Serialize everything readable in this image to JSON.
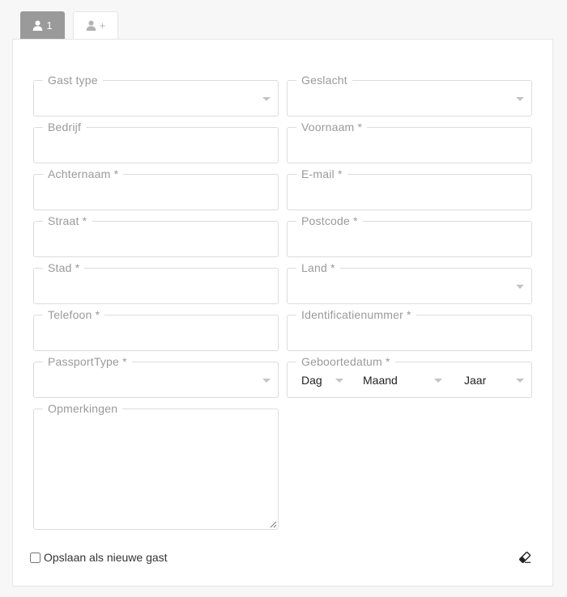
{
  "tabs": [
    {
      "label": "1",
      "icon": "user-icon",
      "active": true
    },
    {
      "label": "+",
      "icon": "user-add-icon",
      "active": false
    }
  ],
  "form": {
    "guest_type": {
      "label": "Gast type",
      "value": ""
    },
    "gender": {
      "label": "Geslacht",
      "value": ""
    },
    "company": {
      "label": "Bedrijf",
      "value": ""
    },
    "first_name": {
      "label": "Voornaam *",
      "value": ""
    },
    "last_name": {
      "label": "Achternaam *",
      "value": ""
    },
    "email": {
      "label": "E-mail *",
      "value": ""
    },
    "street": {
      "label": "Straat *",
      "value": ""
    },
    "postcode": {
      "label": "Postcode *",
      "value": ""
    },
    "city": {
      "label": "Stad *",
      "value": ""
    },
    "country": {
      "label": "Land *",
      "value": ""
    },
    "phone": {
      "label": "Telefoon *",
      "value": ""
    },
    "id_number": {
      "label": "Identificatienummer *",
      "value": ""
    },
    "passport_type": {
      "label": "PassportType *",
      "value": ""
    },
    "birthdate": {
      "label": "Geboortedatum *",
      "day": "Dag",
      "month": "Maand",
      "year": "Jaar"
    },
    "remarks": {
      "label": "Opmerkingen",
      "value": ""
    }
  },
  "footer": {
    "save_new_guest_label": "Opslaan als nieuwe gast",
    "save_new_guest_checked": false,
    "clear_icon": "eraser-icon"
  },
  "colors": {
    "tab_active_bg": "#9a9a9a",
    "label_text": "#9a9a9a",
    "border": "#dcdcdc"
  }
}
